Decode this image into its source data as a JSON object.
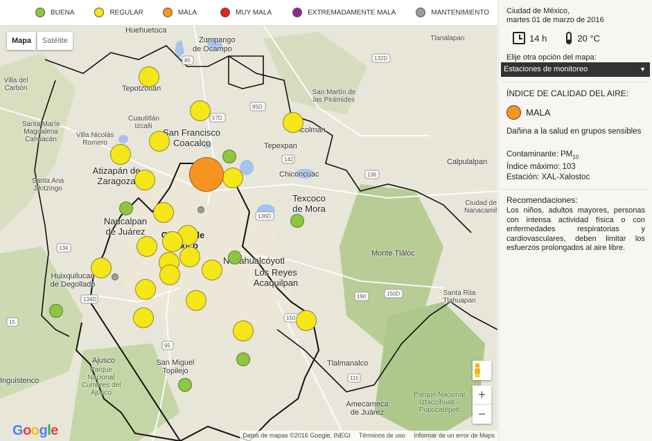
{
  "legend": {
    "items": [
      {
        "label": "BUENA",
        "color": "#8dc63f"
      },
      {
        "label": "REGULAR",
        "color": "#f5e617"
      },
      {
        "label": "MALA",
        "color": "#f7941d"
      },
      {
        "label": "MUY MALA",
        "color": "#e2231a"
      },
      {
        "label": "EXTREMADAMENTE MALA",
        "color": "#92278f"
      },
      {
        "label": "MANTENIMIENTO",
        "color": "#9b9b9b"
      }
    ]
  },
  "map": {
    "tabs": {
      "mapa": "Mapa",
      "satelite": "Satélite"
    },
    "zoom_in": "+",
    "zoom_out": "−",
    "google_logo": "Google",
    "attribution": {
      "data": "Datos de mapas ©2016 Google, INEGI",
      "terms": "Términos de uso",
      "report": "Informar de un error de Maps"
    },
    "places": {
      "huehuetoca": "Huehuetoca",
      "zumpango": "Zumpango",
      "de_ocampo": "de Ocampo",
      "tlanalapan": "Tlanalapan",
      "tepotzotlan": "Tepotzotlán",
      "villa_carbon": "Villa del Carbón",
      "cuautitlan": "Cuautitlán Izcalli",
      "san_francisco": "San Francisco",
      "coacalco": "Coacalco",
      "acolman": "Acolman",
      "tepexpan": "Tepexpan",
      "san_martin": "San Martín de las Pirámides",
      "santa_maria": "Santa María Magdalena Cahuacán",
      "villa_nicolas": "Villa Nicolás Romero",
      "atizapan": "Atizapán de Zaragoza",
      "chiconcuac": "Chiconcuac",
      "calpulalpan": "Calpulalpan",
      "santa_ana": "Santa Ana Jilotzingo",
      "texcoco": "Texcoco de Mora",
      "naucalpan": "Naucalpan de Juárez",
      "ciudad": "Ciudad de México",
      "nanacamilpa": "Ciudad de Nanacamilpa",
      "nezahualcoyotl": "Nezahualcóyotl",
      "los_reyes": "Los Reyes Acaquilpan",
      "monte_tlaloc": "Monte Tláloc",
      "huixquilucan": "Huixquilucan de Degollado",
      "santa_rita": "Santa Rita Tlahuapan",
      "ajusco": "Ajusco",
      "parque_ajusco": "Parque Nacional Cumbres del Ajusco",
      "san_miguel": "San Miguel Topilejo",
      "tlalmanalco": "Tlalmanalco",
      "amecameca": "Amecameca de Juárez",
      "parque_izta": "Parque Nacional Iztaccíhuatl - Popocatépetl",
      "inguistenco": "Inguistenco"
    },
    "highways": [
      "57D",
      "85",
      "85D",
      "132D",
      "136",
      "142",
      "136D",
      "150D",
      "150",
      "190",
      "115",
      "95",
      "134",
      "134D",
      "15"
    ]
  },
  "sidebar": {
    "city": "Ciudad de México,",
    "date": "martes 01 de marzo de 2016",
    "hour": "14 h",
    "temperature": "20 °C",
    "option_label": "Elije otra opción del mapa:",
    "select_value": "Estaciones de monitoreo",
    "index_title": "ÍNDICE DE CALIDAD DEL AIRE:",
    "status_label": "MALA",
    "status_color": "#f7941d",
    "description": "Dañina a la salud en grupos sensibles",
    "pollutant_label": "Contaminante:",
    "pollutant_value": "PM",
    "pollutant_sub": "10",
    "max_label": "Índice máximo:",
    "max_value": "103",
    "station_label": "Estación:",
    "station_value": "XAL-Xalostoc",
    "recommendations_title": "Recomendaciones:",
    "recommendations_text": "Los niños, adultos mayores, personas con intensa actividad física o con enfermedades respiratorias y cardiovasculares, deben limitar los esfuerzos prolongados al aire libre."
  }
}
